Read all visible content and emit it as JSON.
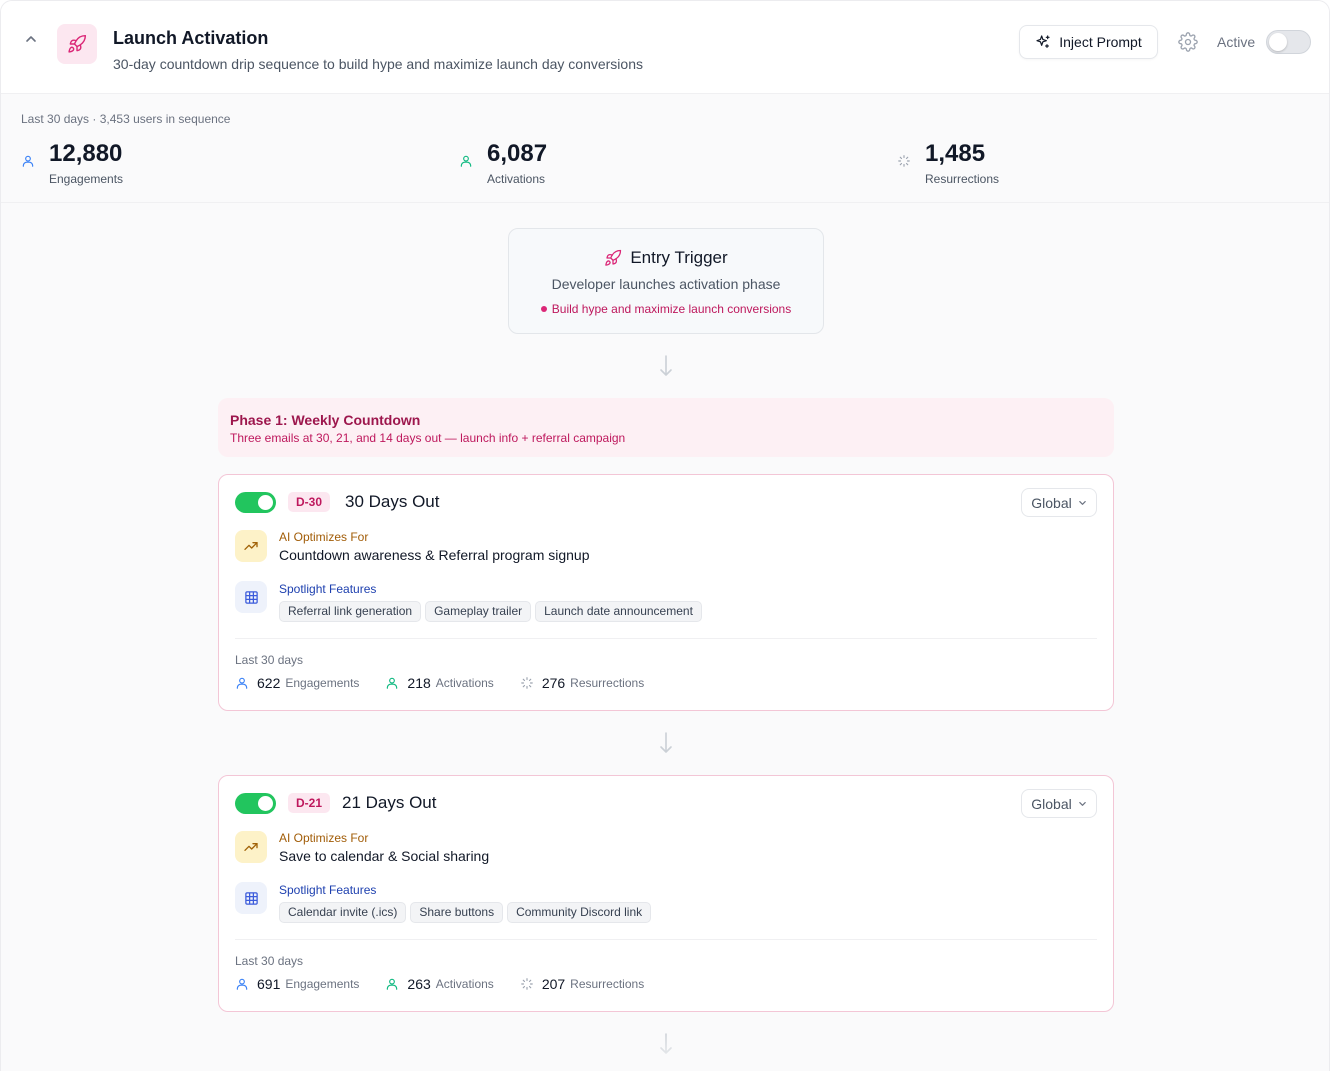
{
  "header": {
    "title": "Launch Activation",
    "subtitle": "30-day countdown drip sequence to build hype and maximize launch day conversions",
    "inject_label": "Inject Prompt",
    "active_label": "Active",
    "active_on": false
  },
  "summary": {
    "caption": "Last 30 days · 3,453 users in sequence",
    "stats": [
      {
        "value": "12,880",
        "label": "Engagements",
        "icon": "user-icon",
        "color": "#3b82f6"
      },
      {
        "value": "6,087",
        "label": "Activations",
        "icon": "user-check-icon",
        "color": "#10b981"
      },
      {
        "value": "1,485",
        "label": "Resurrections",
        "icon": "sparkle-icon",
        "color": "#9ca3af"
      }
    ]
  },
  "trigger": {
    "title": "Entry Trigger",
    "description": "Developer launches activation phase",
    "goal": "Build hype and maximize launch conversions"
  },
  "phase": {
    "title": "Phase 1: Weekly Countdown",
    "description": "Three emails at 30, 21, and 14 days out — launch info + referral campaign"
  },
  "steps": [
    {
      "badge": "D-30",
      "title": "30 Days Out",
      "scope": "Global",
      "enabled": true,
      "ai_label": "AI Optimizes For",
      "ai_value": "Countdown awareness & Referral program signup",
      "spotlight_label": "Spotlight Features",
      "features": [
        "Referral link generation",
        "Gameplay trailer",
        "Launch date announcement"
      ],
      "period": "Last 30 days",
      "metrics": {
        "engagements": {
          "value": "622",
          "label": "Engagements"
        },
        "activations": {
          "value": "218",
          "label": "Activations"
        },
        "resurrections": {
          "value": "276",
          "label": "Resurrections"
        }
      }
    },
    {
      "badge": "D-21",
      "title": "21 Days Out",
      "scope": "Global",
      "enabled": true,
      "ai_label": "AI Optimizes For",
      "ai_value": "Save to calendar & Social sharing",
      "spotlight_label": "Spotlight Features",
      "features": [
        "Calendar invite (.ics)",
        "Share buttons",
        "Community Discord link"
      ],
      "period": "Last 30 days",
      "metrics": {
        "engagements": {
          "value": "691",
          "label": "Engagements"
        },
        "activations": {
          "value": "263",
          "label": "Activations"
        },
        "resurrections": {
          "value": "207",
          "label": "Resurrections"
        }
      }
    }
  ],
  "colors": {
    "accent_pink": "#be185d",
    "toggle_on": "#22c55e",
    "ai_amber": "#a15c07",
    "spotlight_blue": "#1e40af"
  }
}
